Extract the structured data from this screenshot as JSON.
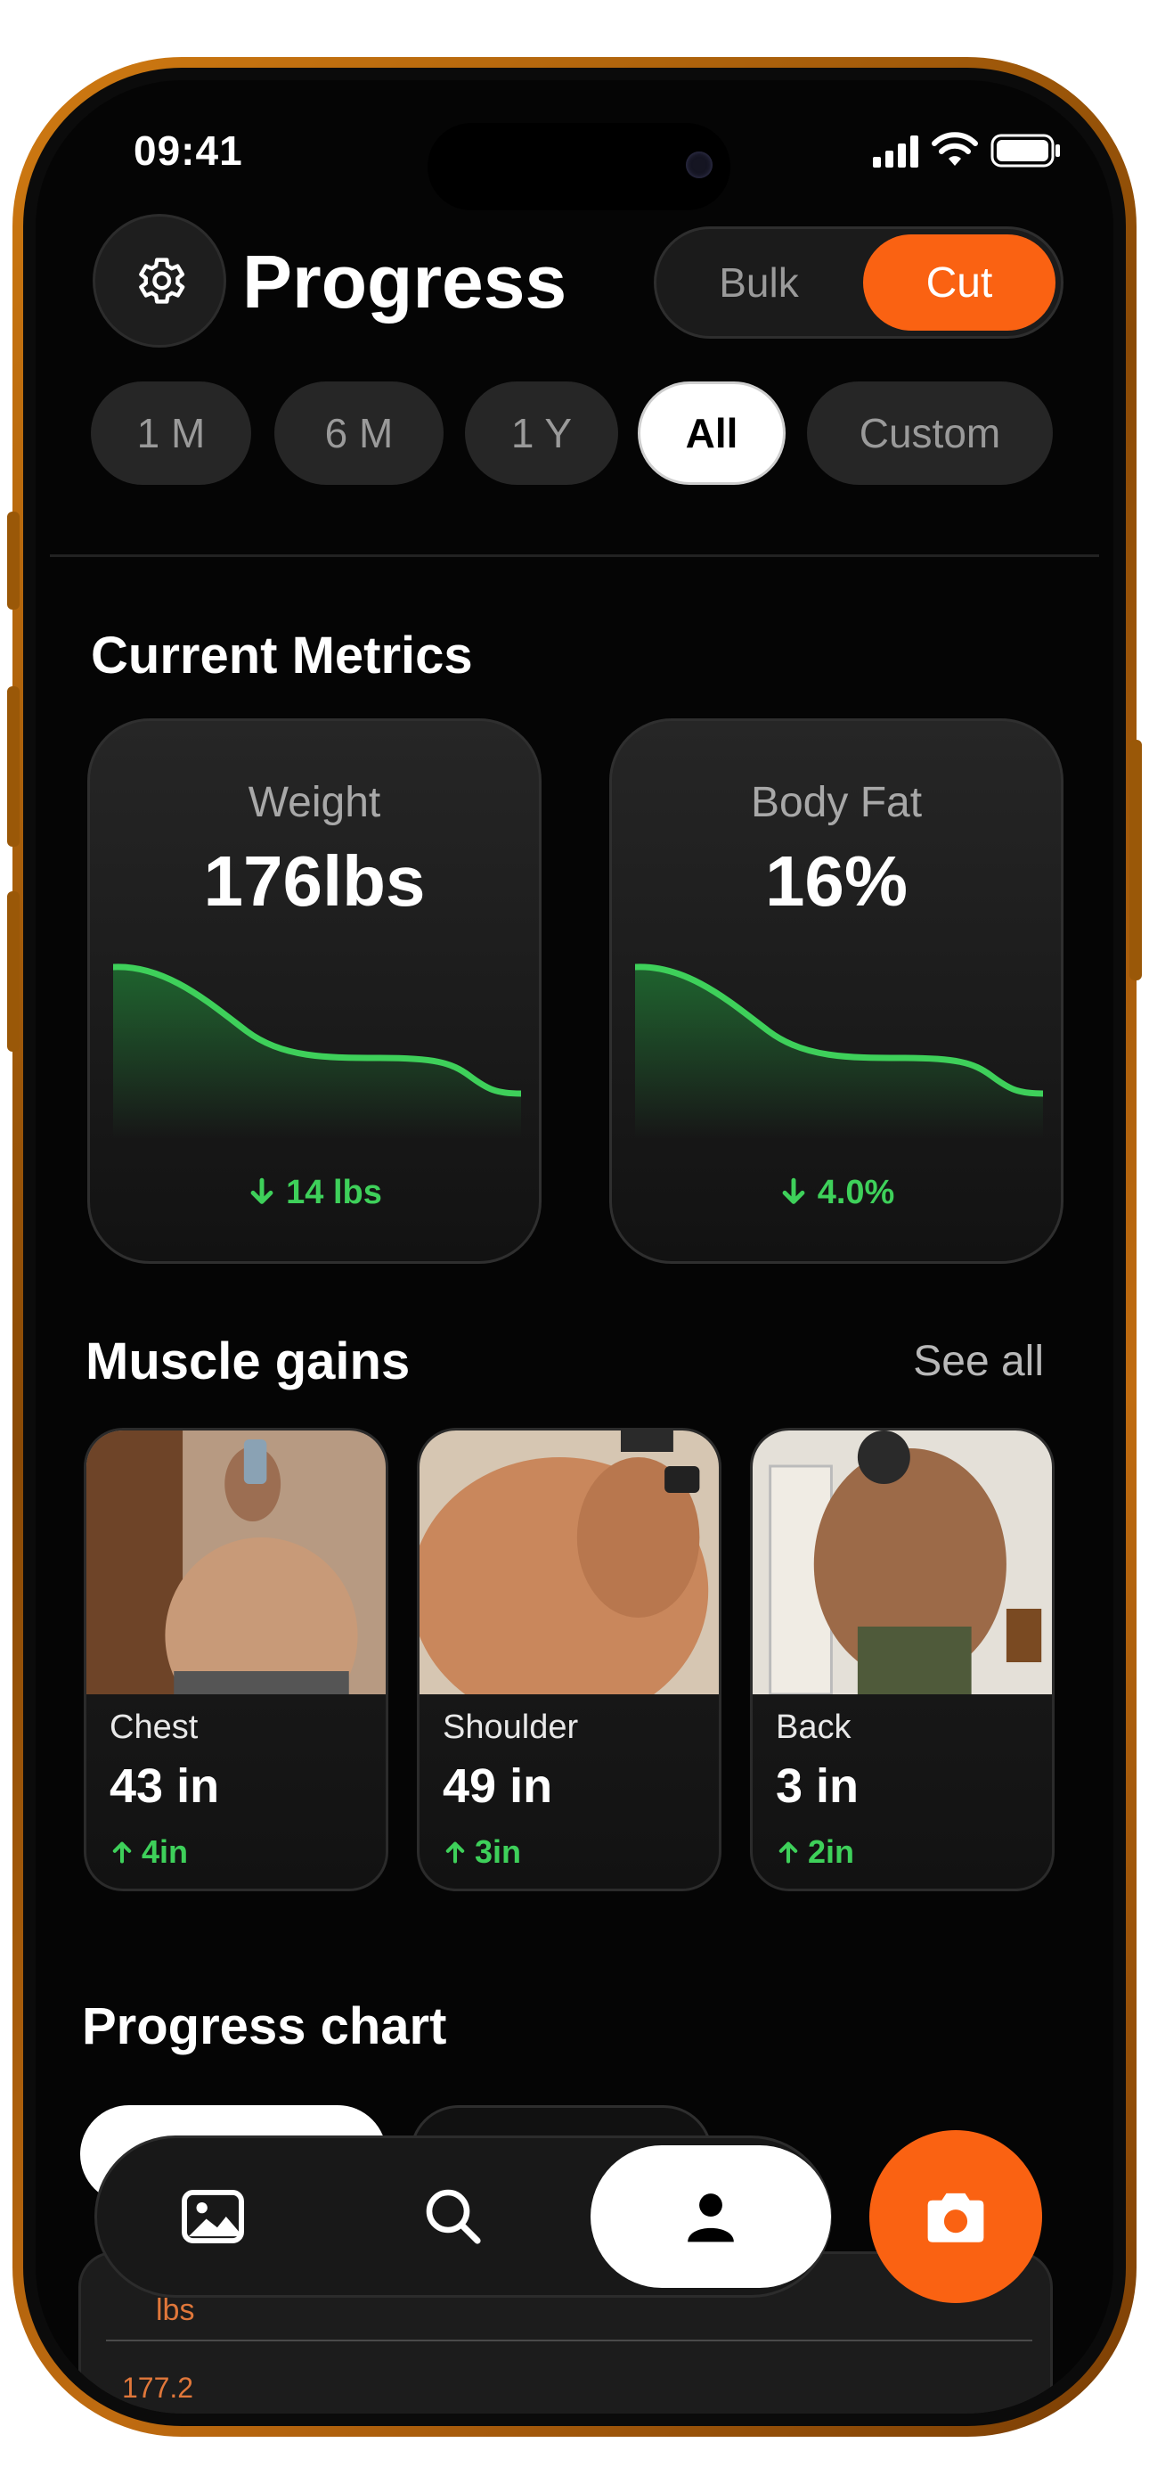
{
  "status_bar": {
    "time": "09:41"
  },
  "header": {
    "title": "Progress",
    "mode_options": [
      "Bulk",
      "Cut"
    ],
    "mode_selected": "Cut"
  },
  "range_filters": [
    {
      "label": "1 M",
      "active": false
    },
    {
      "label": "6 M",
      "active": false
    },
    {
      "label": "1 Y",
      "active": false
    },
    {
      "label": "All",
      "active": true
    },
    {
      "label": "Custom",
      "active": false
    }
  ],
  "current_metrics": {
    "title": "Current Metrics",
    "cards": [
      {
        "label": "Weight",
        "value": "176lbs",
        "delta": "14 lbs",
        "trend": "down"
      },
      {
        "label": "Body Fat",
        "value": "16%",
        "delta": "4.0%",
        "trend": "down"
      }
    ]
  },
  "muscle_gains": {
    "title": "Muscle gains",
    "see_all_label": "See all",
    "items": [
      {
        "label": "Chest",
        "value": "43 in",
        "delta": "4in",
        "trend": "up"
      },
      {
        "label": "Shoulder",
        "value": "49 in",
        "delta": "3in",
        "trend": "up"
      },
      {
        "label": "Back",
        "value": "3 in",
        "delta": "2in",
        "trend": "up"
      }
    ]
  },
  "progress_chart": {
    "title": "Progress chart",
    "unit_label": "lbs",
    "first_tick": "177.2"
  },
  "bottom_nav": {
    "items": [
      "gallery-icon",
      "search-icon",
      "profile-icon"
    ],
    "active": "profile-icon",
    "action": "camera-icon"
  },
  "colors": {
    "accent": "#fa6212",
    "positive": "#3ed05a",
    "background": "#050505",
    "card": "#1e1e1e"
  }
}
